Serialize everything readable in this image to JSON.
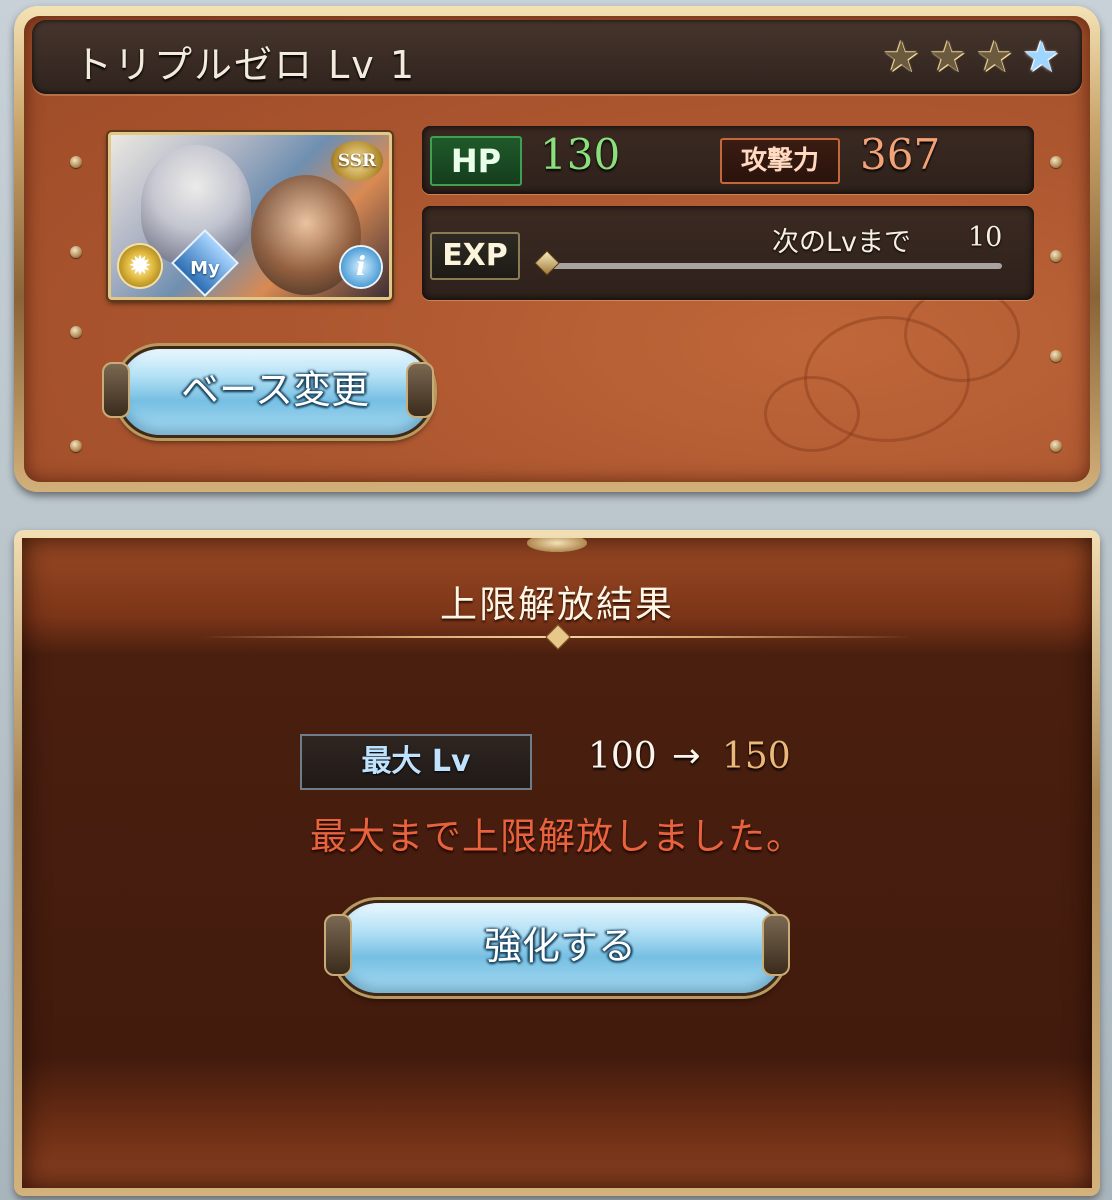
{
  "weapon": {
    "title": "トリプルゼロ Lv 1",
    "stars": [
      {
        "icon": "star-icon",
        "state": "uncap"
      },
      {
        "icon": "star-icon",
        "state": "uncap"
      },
      {
        "icon": "star-icon",
        "state": "uncap"
      },
      {
        "icon": "star-icon",
        "state": "transcend"
      }
    ],
    "rarity": "SSR",
    "my_badge": "My",
    "info_glyph": "i",
    "stats": {
      "hp_label": "HP",
      "hp_value": "130",
      "atk_label": "攻撃力",
      "atk_value": "367",
      "exp_label": "EXP",
      "next_label": "次のLvまで",
      "next_value": "10",
      "exp_fraction": 0.0
    },
    "base_change_button": "ベース変更"
  },
  "result": {
    "title": "上限解放結果",
    "max_lv_label": "最大 Lv",
    "lv_from": "100",
    "arrow": "→",
    "lv_to": "150",
    "message": "最大まで上限解放しました。",
    "enhance_button": "強化する"
  },
  "colors": {
    "hp_value": "#8be07e",
    "atk_value": "#f3a275",
    "lv_to": "#ecb87a",
    "message": "#e8623e"
  }
}
